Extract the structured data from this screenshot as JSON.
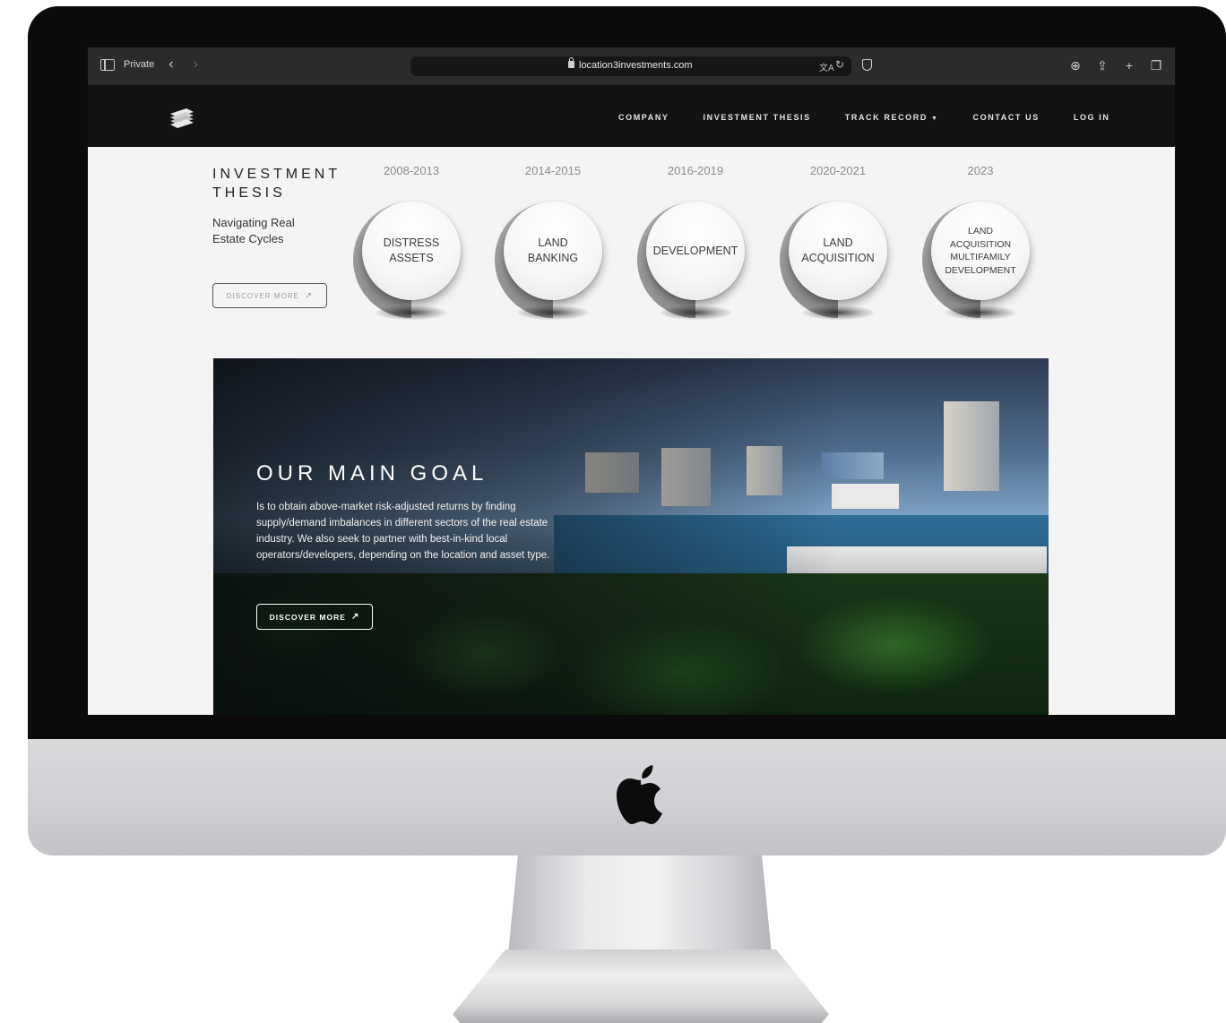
{
  "browser": {
    "private_label": "Private",
    "url": "location3investments.com"
  },
  "nav": {
    "items": [
      {
        "label": "COMPANY"
      },
      {
        "label": "INVESTMENT THESIS"
      },
      {
        "label": "TRACK RECORD"
      },
      {
        "label": "CONTACT US"
      },
      {
        "label": "LOG IN"
      }
    ]
  },
  "thesis": {
    "title_line1": "INVESTMENT",
    "title_line2": "THESIS",
    "subtitle": "Navigating Real Estate Cycles",
    "button_label": "DISCOVER MORE"
  },
  "cycles": [
    {
      "years": "2008-2013",
      "label": "DISTRESS ASSETS"
    },
    {
      "years": "2014-2015",
      "label": "LAND BANKING"
    },
    {
      "years": "2016-2019",
      "label": "DEVELOPMENT"
    },
    {
      "years": "2020-2021",
      "label": "LAND ACQUISITION"
    },
    {
      "years": "2023",
      "label": "LAND ACQUISITION MULTIFAMILY DEVELOPMENT"
    }
  ],
  "hero": {
    "title": "OUR MAIN GOAL",
    "body": "Is to obtain above-market risk-adjusted returns by finding supply/demand imbalances in different sectors of the real estate industry. We also seek to partner with best-in-kind local operators/developers, depending on the location and asset type.",
    "button_label": "DISCOVER MORE"
  },
  "colors": {
    "nav_bg": "#131313",
    "page_bg": "#f4f4f4",
    "browser_bar": "#2b2b2d"
  }
}
